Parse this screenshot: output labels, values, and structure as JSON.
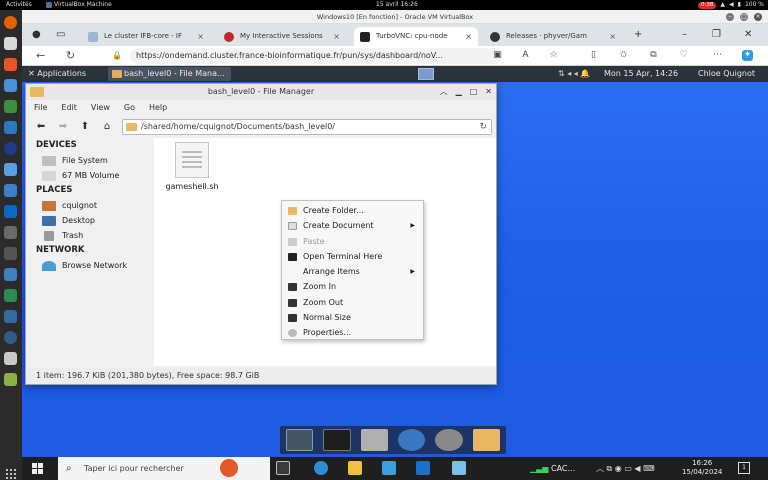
{
  "ubuntu_bar": {
    "activities": "Activités",
    "vm_app": "VirtualBox Machine",
    "clock": "15 avril 16:26",
    "record_badge": "0:38",
    "battery": "100 %"
  },
  "vbox": {
    "title": "Windows10 [En fonction] - Oracle VM VirtualBox"
  },
  "browser": {
    "tabs": [
      {
        "label": "Le cluster IFB-core - IF",
        "icon": "ifb-icon"
      },
      {
        "label": "My Interactive Sessions",
        "icon": "ondemand-icon"
      },
      {
        "label": "TurboVNC: cpu-node",
        "icon": "turbovnc-icon"
      },
      {
        "label": "Releases · phyver/Gam",
        "icon": "github-icon"
      }
    ],
    "url": "https://ondemand.cluster.france-bioinformatique.fr/pun/sys/dashboard/noV..."
  },
  "xfce_panel": {
    "applications": "Applications",
    "task": "bash_level0 - File Mana...",
    "clock": "Mon 15 Apr, 14:26",
    "user": "Chloe Quignot"
  },
  "file_manager": {
    "title": "bash_level0 - File Manager",
    "menu": [
      "File",
      "Edit",
      "View",
      "Go",
      "Help"
    ],
    "location": "/shared/home/cquignot/Documents/bash_level0/",
    "sections": {
      "devices": "DEVICES",
      "places": "PLACES",
      "network": "NETWORK"
    },
    "devices": [
      "File System",
      "67 MB Volume"
    ],
    "places": [
      "cquignot",
      "Desktop",
      "Trash"
    ],
    "network": [
      "Browse Network"
    ],
    "files": [
      {
        "name": "gameshell.sh"
      }
    ],
    "status": "1 item: 196.7 KiB (201,380 bytes), Free space: 98.7 GiB"
  },
  "context_menu": [
    {
      "label": "Create Folder...",
      "icon": "folder-plus-icon",
      "disabled": false,
      "submenu": false
    },
    {
      "label": "Create Document",
      "icon": "document-plus-icon",
      "disabled": false,
      "submenu": true
    },
    {
      "label": "Paste",
      "icon": "paste-icon",
      "disabled": true,
      "submenu": false
    },
    {
      "label": "Open Terminal Here",
      "icon": "terminal-icon",
      "disabled": false,
      "submenu": false
    },
    {
      "label": "Arrange Items",
      "icon": "",
      "disabled": false,
      "submenu": true
    },
    {
      "label": "Zoom In",
      "icon": "zoom-in-icon",
      "disabled": false,
      "submenu": false
    },
    {
      "label": "Zoom Out",
      "icon": "zoom-out-icon",
      "disabled": false,
      "submenu": false
    },
    {
      "label": "Normal Size",
      "icon": "normal-size-icon",
      "disabled": false,
      "submenu": false
    },
    {
      "label": "Properties...",
      "icon": "properties-icon",
      "disabled": false,
      "submenu": false
    }
  ],
  "windows_taskbar": {
    "search_placeholder": "Taper ici pour rechercher",
    "weather": "CAC...",
    "time": "16:26",
    "date": "15/04/2024",
    "notifications": "1"
  },
  "colors": {
    "desktop_blue": "#1f5be0",
    "xfce_panel": "#2d333c",
    "folder_yellow": "#e9b961"
  }
}
